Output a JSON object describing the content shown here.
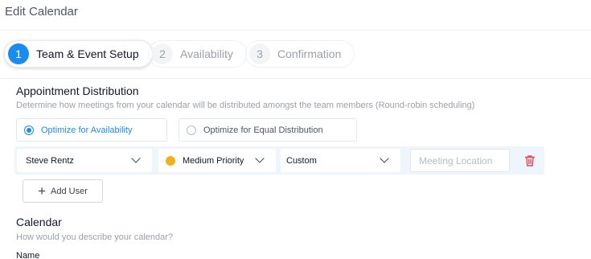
{
  "header": {
    "title": "Edit Calendar"
  },
  "stepper": {
    "steps": [
      {
        "number": "1",
        "label": "Team & Event Setup"
      },
      {
        "number": "2",
        "label": "Availability"
      },
      {
        "number": "3",
        "label": "Confirmation"
      }
    ]
  },
  "distribution": {
    "title": "Appointment Distribution",
    "description": "Determine how meetings from your calendar will be distributed amongst the team members (Round-robin scheduling)",
    "options": [
      {
        "label": "Optimize for Availability",
        "selected": true
      },
      {
        "label": "Optimize for Equal Distribution",
        "selected": false
      }
    ]
  },
  "team_row": {
    "user": "Steve Rentz",
    "priority": "Medium Priority",
    "priority_color": "#f0b21c",
    "location_type": "Custom",
    "location_placeholder": "Meeting Location",
    "delete_color": "#e5484d"
  },
  "add_user_label": "Add User",
  "calendar": {
    "title": "Calendar",
    "description": "How would you describe your calendar?",
    "name_label": "Name"
  },
  "colors": {
    "accent": "#1a8cf0"
  }
}
